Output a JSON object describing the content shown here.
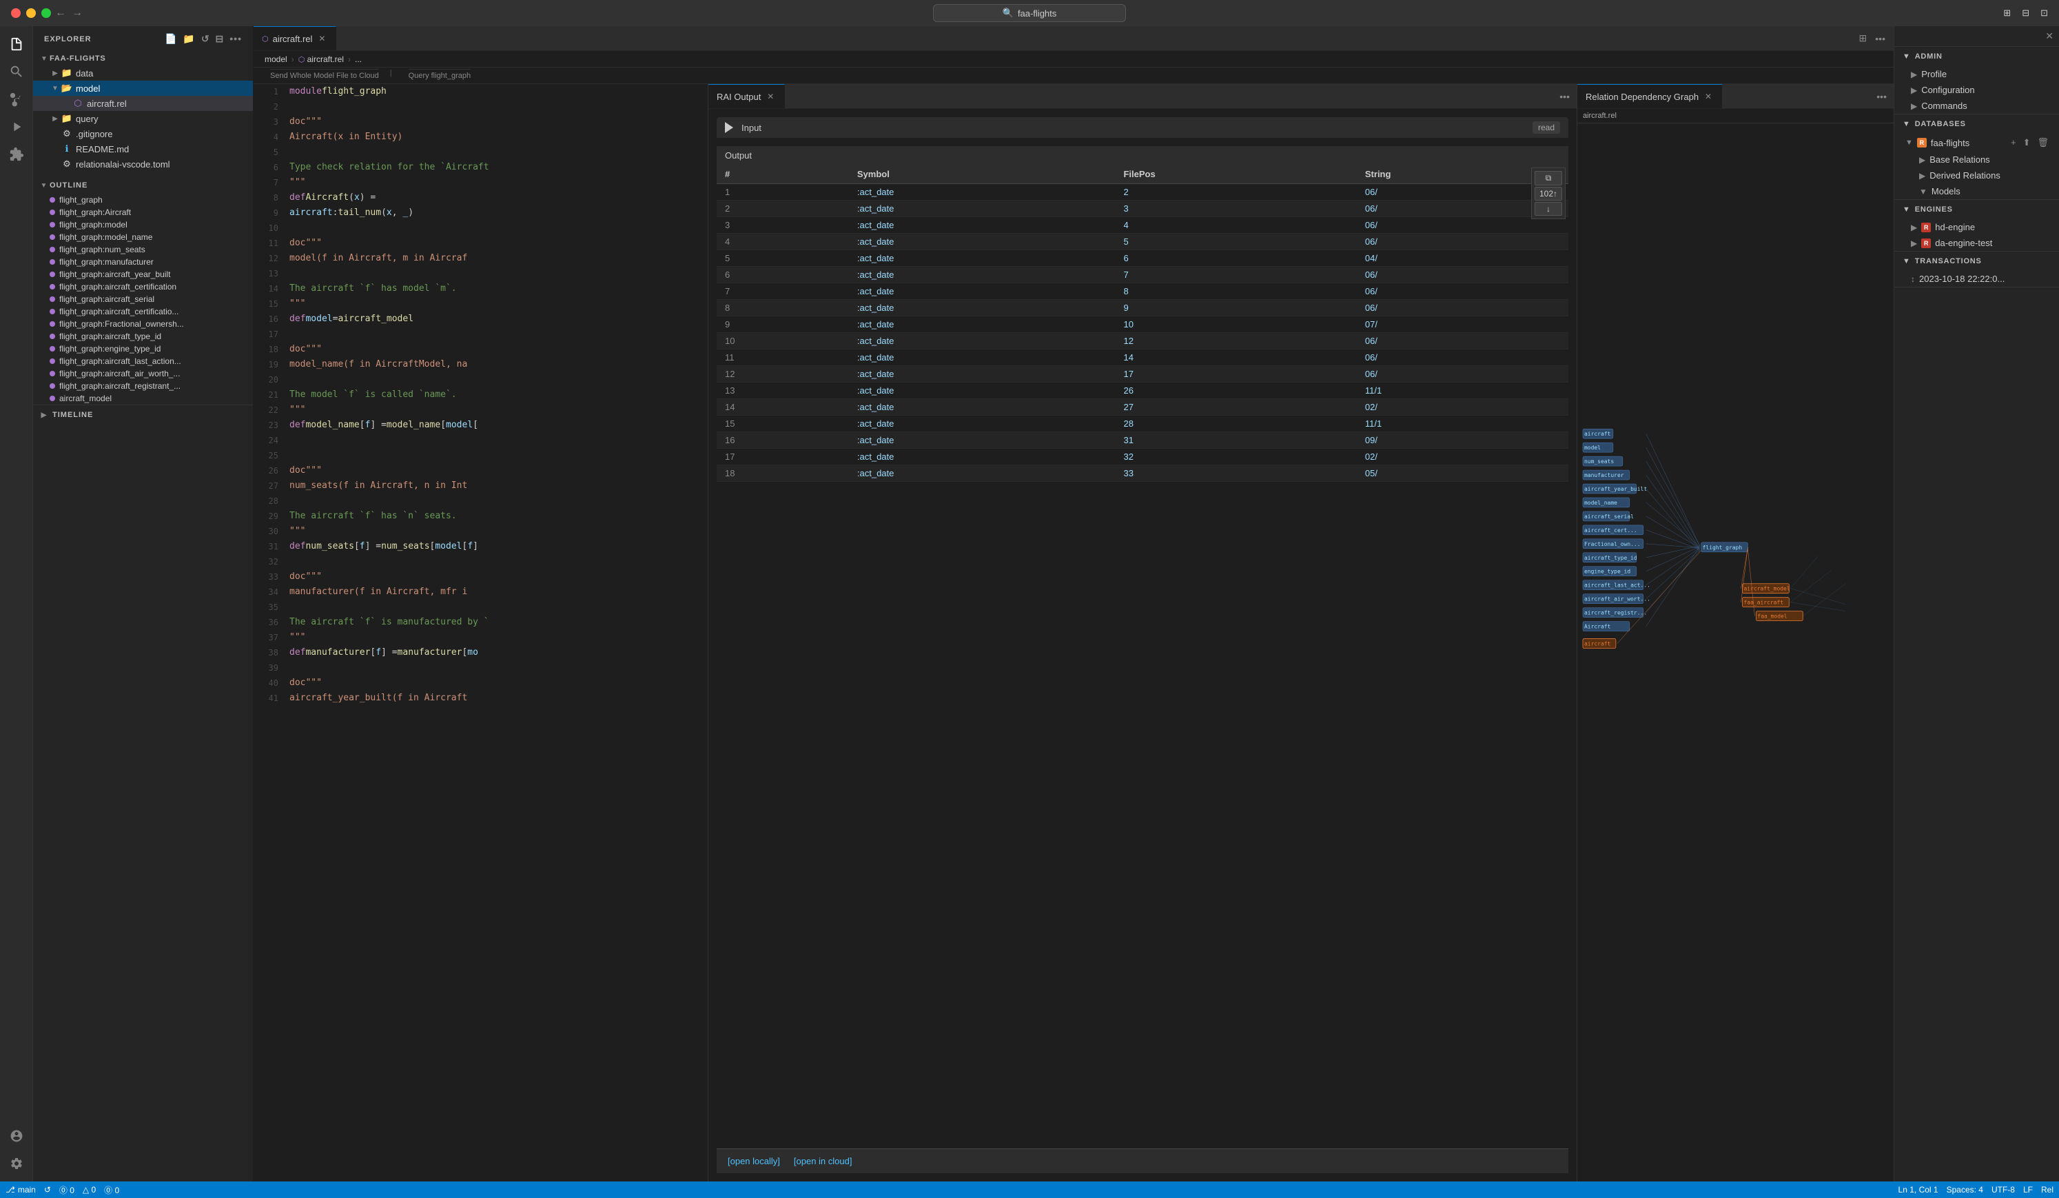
{
  "titlebar": {
    "search_placeholder": "faa-flights",
    "back_label": "←",
    "forward_label": "→"
  },
  "activity_bar": {
    "icons": [
      "explorer",
      "search",
      "source-control",
      "run",
      "extensions"
    ],
    "bottom_icons": [
      "account",
      "settings"
    ]
  },
  "sidebar": {
    "explorer_title": "EXPLORER",
    "workspace_name": "FAA-FLIGHTS",
    "folders": [
      {
        "name": "data",
        "type": "folder",
        "expanded": false
      },
      {
        "name": "model",
        "type": "folder",
        "expanded": true,
        "active": true
      },
      {
        "name": "query",
        "type": "folder",
        "expanded": false
      }
    ],
    "files": [
      {
        "name": ".gitignore",
        "type": "gear"
      },
      {
        "name": "README.md",
        "type": "info"
      },
      {
        "name": "relationalai-vscode.toml",
        "type": "gear"
      }
    ],
    "model_files": [
      "aircraft.rel"
    ],
    "outline_title": "OUTLINE",
    "outline_items": [
      "flight_graph",
      "flight_graph:Aircraft",
      "flight_graph:model",
      "flight_graph:model_name",
      "flight_graph:num_seats",
      "flight_graph:manufacturer",
      "flight_graph:aircraft_year_built",
      "flight_graph:aircraft_certification",
      "flight_graph:aircraft_serial",
      "flight_graph:aircraft_certificatio...",
      "flight_graph:Fractional_ownersh...",
      "flight_graph:aircraft_type_id",
      "flight_graph:engine_type_id",
      "flight_graph:aircraft_last_action...",
      "flight_graph:aircraft_air_worth_...",
      "flight_graph:aircraft_registrant_...",
      "aircraft_model"
    ],
    "timeline_title": "TIMELINE"
  },
  "editor": {
    "tab_label": "aircraft.rel",
    "tab_icon": "⬡",
    "breadcrumb": [
      "model",
      "aircraft.rel",
      "..."
    ],
    "context_hint1": "Send Whole Model File to Cloud",
    "context_hint2": "Query flight_graph",
    "lines": [
      {
        "num": 1,
        "code": "module flight_graph"
      },
      {
        "num": 2,
        "code": ""
      },
      {
        "num": 3,
        "code": "    doc\"\"\""
      },
      {
        "num": 4,
        "code": "        Aircraft(x in Entity)"
      },
      {
        "num": 5,
        "code": ""
      },
      {
        "num": 6,
        "code": "    Type check relation for the `Aircraft"
      },
      {
        "num": 7,
        "code": "    \"\"\""
      },
      {
        "num": 8,
        "code": "    def Aircraft(x) ="
      },
      {
        "num": 9,
        "code": "        aircraft:tail_num(x, _)"
      },
      {
        "num": 10,
        "code": ""
      },
      {
        "num": 11,
        "code": "    doc\"\"\""
      },
      {
        "num": 12,
        "code": "        model(f in Aircraft, m in Aircraf"
      },
      {
        "num": 13,
        "code": ""
      },
      {
        "num": 14,
        "code": "    The aircraft `f` has model `m`."
      },
      {
        "num": 15,
        "code": "    \"\"\""
      },
      {
        "num": 16,
        "code": "    def model = aircraft_model"
      },
      {
        "num": 17,
        "code": ""
      },
      {
        "num": 18,
        "code": "    doc\"\"\""
      },
      {
        "num": 19,
        "code": "        model_name(f in AircraftModel, na"
      },
      {
        "num": 20,
        "code": ""
      },
      {
        "num": 21,
        "code": "    The model `f` is called `name`."
      },
      {
        "num": 22,
        "code": "    \"\"\""
      },
      {
        "num": 23,
        "code": "    def model_name[f] = model_name[model["
      },
      {
        "num": 24,
        "code": ""
      },
      {
        "num": 25,
        "code": ""
      },
      {
        "num": 26,
        "code": "    doc\"\"\""
      },
      {
        "num": 27,
        "code": "        num_seats(f in Aircraft, n in Int"
      },
      {
        "num": 28,
        "code": ""
      },
      {
        "num": 29,
        "code": "    The aircraft `f` has `n` seats."
      },
      {
        "num": 30,
        "code": "    \"\"\""
      },
      {
        "num": 31,
        "code": "    def num_seats[f] = num_seats[model[f]"
      },
      {
        "num": 32,
        "code": ""
      },
      {
        "num": 33,
        "code": "    doc\"\"\""
      },
      {
        "num": 34,
        "code": "        manufacturer(f in Aircraft, mfr i"
      },
      {
        "num": 35,
        "code": ""
      },
      {
        "num": 36,
        "code": "    The aircraft `f` is manufactured by `"
      },
      {
        "num": 37,
        "code": "    \"\"\""
      },
      {
        "num": 38,
        "code": "    def manufacturer[f] = manufacturer[mo"
      },
      {
        "num": 39,
        "code": ""
      },
      {
        "num": 40,
        "code": "    doc\"\"\""
      },
      {
        "num": 41,
        "code": "        aircraft_year_built(f in Aircraft"
      }
    ]
  },
  "rai_output": {
    "tab_label": "RAI Output",
    "input_label": "Input",
    "input_badge": "read",
    "output_label": "Output",
    "table_columns": [
      "#",
      "Symbol",
      "FilePos",
      "String"
    ],
    "table_rows": [
      {
        "row": 1,
        "symbol": ":act_date",
        "filepos": 2,
        "val": "06/"
      },
      {
        "row": 2,
        "symbol": ":act_date",
        "filepos": 3,
        "val": "06/"
      },
      {
        "row": 3,
        "symbol": ":act_date",
        "filepos": 4,
        "val": "06/"
      },
      {
        "row": 4,
        "symbol": ":act_date",
        "filepos": 5,
        "val": "06/"
      },
      {
        "row": 5,
        "symbol": ":act_date",
        "filepos": 6,
        "val": "04/"
      },
      {
        "row": 6,
        "symbol": ":act_date",
        "filepos": 7,
        "val": "06/"
      },
      {
        "row": 7,
        "symbol": ":act_date",
        "filepos": 8,
        "val": "06/"
      },
      {
        "row": 8,
        "symbol": ":act_date",
        "filepos": 9,
        "val": "06/"
      },
      {
        "row": 9,
        "symbol": ":act_date",
        "filepos": 10,
        "val": "07/"
      },
      {
        "row": 10,
        "symbol": ":act_date",
        "filepos": 12,
        "val": "06/"
      },
      {
        "row": 11,
        "symbol": ":act_date",
        "filepos": 14,
        "val": "06/"
      },
      {
        "row": 12,
        "symbol": ":act_date",
        "filepos": 17,
        "val": "06/"
      },
      {
        "row": 13,
        "symbol": ":act_date",
        "filepos": 26,
        "val": "11/1"
      },
      {
        "row": 14,
        "symbol": ":act_date",
        "filepos": 27,
        "val": "02/"
      },
      {
        "row": 15,
        "symbol": ":act_date",
        "filepos": 28,
        "val": "11/1"
      },
      {
        "row": 16,
        "symbol": ":act_date",
        "filepos": 31,
        "val": "09/"
      },
      {
        "row": 17,
        "symbol": ":act_date",
        "filepos": 32,
        "val": "02/"
      },
      {
        "row": 18,
        "symbol": ":act_date",
        "filepos": 33,
        "val": "05/"
      }
    ],
    "pagination_label": "102↑",
    "pagination_down": "↓",
    "open_locally": "[open locally]",
    "open_in_cloud": "[open in cloud]"
  },
  "rdg": {
    "tab_label": "Relation Dependency Graph",
    "title": "aircraft.rel"
  },
  "right_sidebar": {
    "admin_section": "ADMIN",
    "admin_items": [
      {
        "label": "Profile",
        "expanded": false
      },
      {
        "label": "Configuration",
        "expanded": false
      },
      {
        "label": "Commands",
        "expanded": false
      }
    ],
    "databases_section": "DATABASES",
    "db_name": "faa-flights",
    "db_subsections": [
      {
        "label": "Base Relations",
        "expanded": false
      },
      {
        "label": "Derived Relations",
        "expanded": false
      },
      {
        "label": "Models",
        "expanded": false
      }
    ],
    "engines_section": "ENGINES",
    "engine_items": [
      {
        "label": "hd-engine"
      },
      {
        "label": "da-engine-test"
      }
    ],
    "transactions_section": "TRANSACTIONS",
    "transaction_item": "2023-10-18 22:22:0..."
  },
  "status_bar": {
    "branch": "main",
    "errors": "⓪ 0",
    "warnings": "△ 0",
    "ports": "⓪ 0",
    "position": "Ln 1, Col 1",
    "spaces": "Spaces: 4",
    "encoding": "UTF-8",
    "eol": "LF",
    "language": "Rel"
  }
}
